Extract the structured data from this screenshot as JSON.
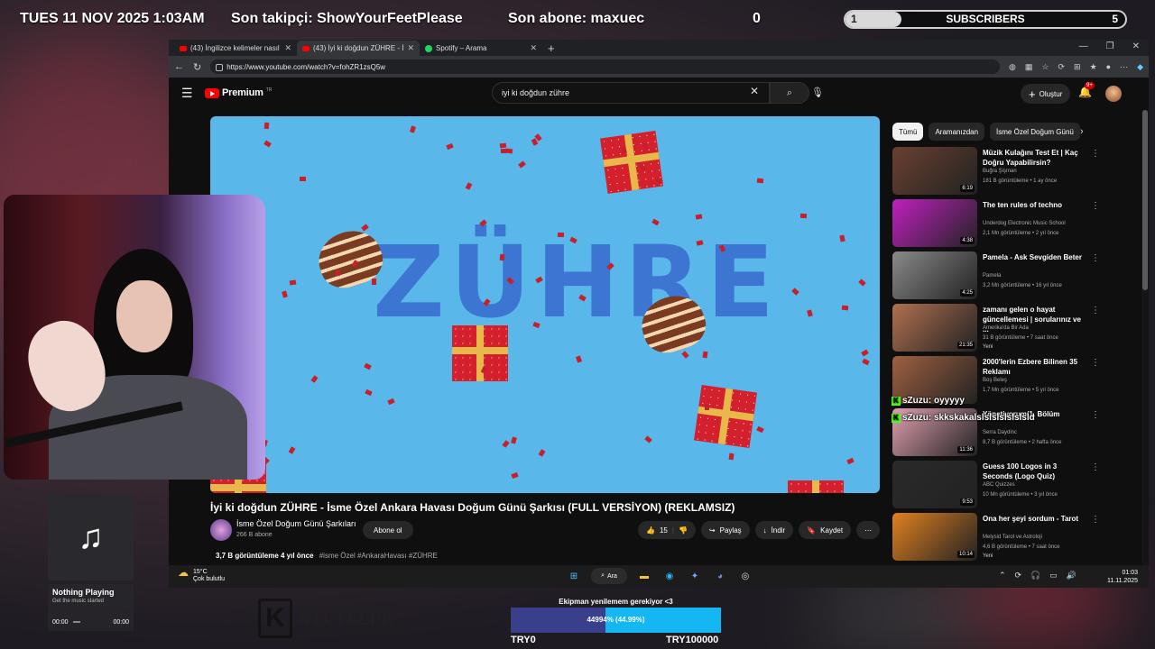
{
  "overlay": {
    "datetime": "TUES 11 NOV 2025 1:03AM",
    "last_follower": "Son takipçi: ShowYourFeetPlease",
    "last_sub": "Son abone: maxuec",
    "count": "0",
    "sub_goal": {
      "current": "1",
      "label": "SUBSCRIBERS",
      "target": "5",
      "progress": 0.2
    }
  },
  "browser": {
    "tabs": [
      {
        "label": "(43) İngilizce kelimeler nasıl doğr",
        "active": false
      },
      {
        "label": "(43) İyi ki doğdun ZÜHRE - İ",
        "active": true
      },
      {
        "label": "Spotify – Arama",
        "active": false
      }
    ],
    "url": "https://www.youtube.com/watch?v=fohZR1zsQ5w"
  },
  "youtube": {
    "logo": "Premium",
    "logo_region": "TR",
    "search_query": "iyi ki doğdun zühre",
    "create_label": "Oluştur",
    "notif_badge": "9+",
    "video_art_text": "ZÜHRE",
    "video_title": "İyi ki doğdun ZÜHRE - İsme Özel Ankara Havası Doğum Günü Şarkısı (FULL VERSİYON) (REKLAMSIZ)",
    "channel": {
      "name": "İsme Özel Doğum Günü Şarkıları",
      "subs": "266 B abone",
      "subscribe_label": "Abone ol"
    },
    "actions": {
      "likes": "15",
      "share": "Paylaş",
      "download": "İndir",
      "save": "Kaydet"
    },
    "meta": {
      "views": "3,7 B görüntüleme  4 yıl önce",
      "tags": "#isme Özel #AnkaraHavası #ZÜHRE"
    },
    "chips": [
      "Tümü",
      "Aramanızdan",
      "İsme Özel Doğum Günü"
    ],
    "recommendations": [
      {
        "title": "Müzik Kulağını Test Et | Kaç Doğru Yapabilirsin?",
        "channel": "Buğra Şişman",
        "stats": "181 B görüntüleme • 1 ay önce",
        "duration": "6:19",
        "thumb_color": "#6a4030"
      },
      {
        "title": "The ten rules of techno",
        "channel": "Underdog Electronic Music School",
        "stats": "2,1 Mn görüntüleme • 2 yıl önce",
        "duration": "4:38",
        "thumb_color": "#c020c0"
      },
      {
        "title": "Pamela - Ask Sevgiden Beter",
        "channel": "Pamela",
        "stats": "3,2 Mn görüntüleme • 16 yıl önce",
        "duration": "4:25",
        "thumb_color": "#8a8a8a"
      },
      {
        "title": "zamanı gelen o hayat güncellemesi | sorularınız ve ...",
        "channel": "Amerika'da Bir Ada",
        "stats": "31 B görüntüleme • 7 saat önce",
        "extra": "Yeni",
        "duration": "21:35",
        "thumb_color": "#b07050"
      },
      {
        "title": "2000'lerin Ezbere Bilinen 35 Reklamı",
        "channel": "Boş Beleş",
        "stats": "1,7 Mn görüntüleme • 5 yıl önce",
        "duration": "",
        "thumb_color": "#a06040"
      },
      {
        "title": "Yönetiyorum(1. Bölüm",
        "channel": "Serra Daydinc",
        "stats": "8,7 B görüntüleme • 2 hafta önce",
        "duration": "11:36",
        "thumb_color": "#e0a0b0"
      },
      {
        "title": "Guess 100 Logos in 3 Seconds (Logo Quiz)",
        "channel": "ABC Quizzes",
        "stats": "10 Mn görüntüleme • 3 yıl önce",
        "duration": "9:53",
        "thumb_color": "#2a2a2a"
      },
      {
        "title": "Ona her şeyi sordum - Tarot",
        "channel": "Melysid Tarot ve Astroloji",
        "stats": "4,6 B görüntüleme • 7 saat önce",
        "extra": "Yeni",
        "duration": "10:14",
        "thumb_color": "#e08020"
      }
    ]
  },
  "chat": [
    {
      "user": "sZuzu",
      "text": ": oyyyyy"
    },
    {
      "user": "sZuzu",
      "text": ": skkskakalslslslslslslsld"
    }
  ],
  "taskbar": {
    "temp": "15°C",
    "weather": "Çok bulutlu",
    "search": "Ara",
    "time": "01:03",
    "date": "11.11.2025"
  },
  "music": {
    "status": "Nothing Playing",
    "sub": "Get the music started",
    "start": "00:00",
    "end": "00:00"
  },
  "brand": {
    "logo_letter": "K",
    "name": "NİCTALPA"
  },
  "goal": {
    "title": "Ekipman yenilemem gerekiyor <3",
    "text": "44994% (44.99%)",
    "progress": 0.4499,
    "min": "TRY0",
    "max": "TRY100000"
  }
}
